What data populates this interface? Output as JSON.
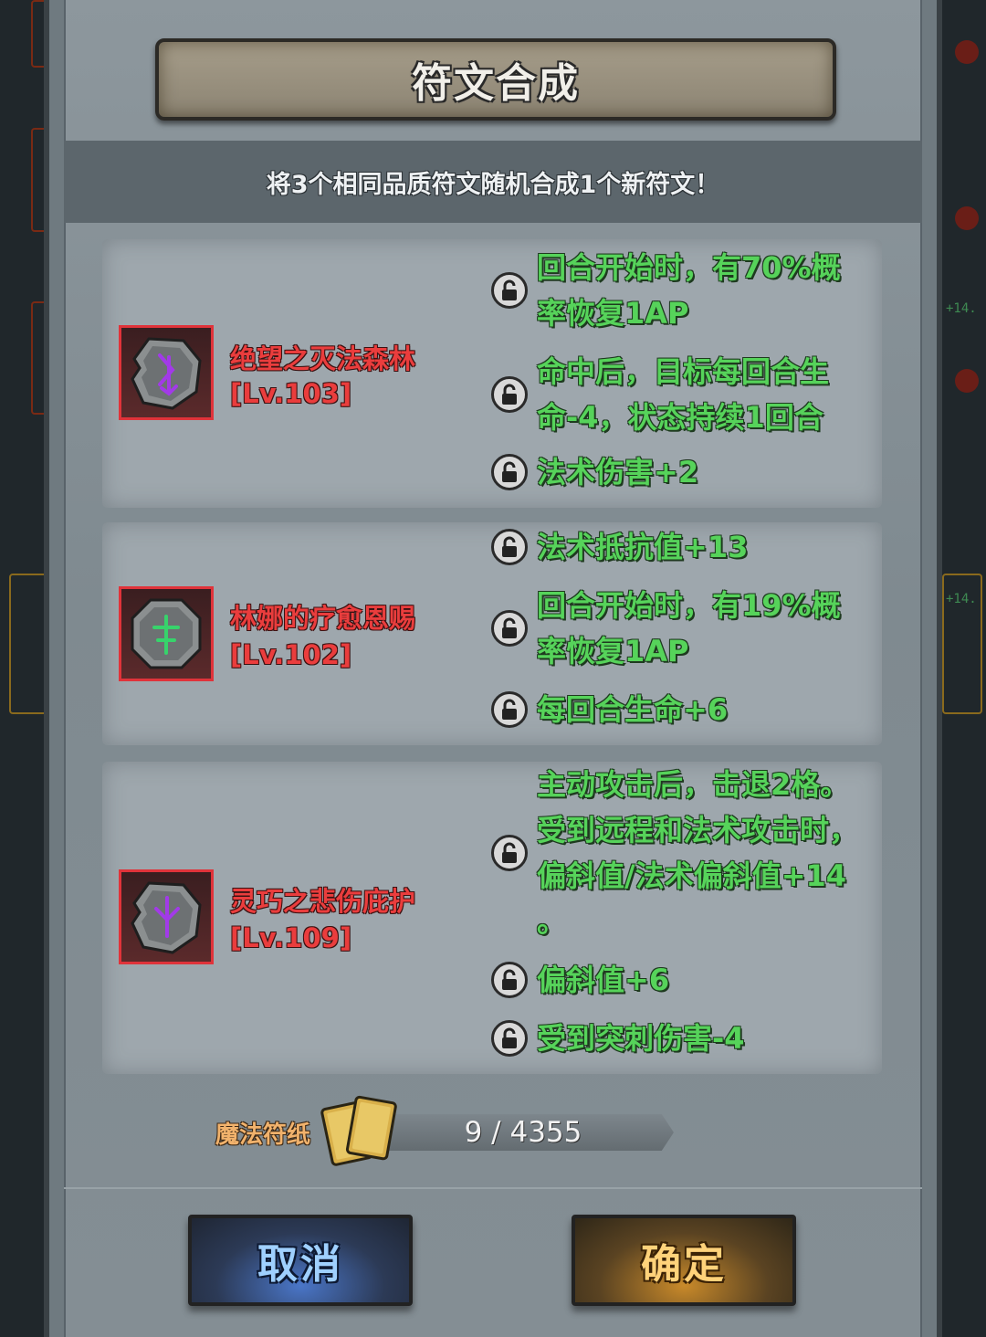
{
  "dialog": {
    "title": "符文合成",
    "subtitle": "将3个相同品质符文随机合成1个新符文！"
  },
  "runes": [
    {
      "name": "绝望之灭法森林",
      "level": "[Lv.103]",
      "glyph_color": "#a23ae8",
      "attributes": [
        {
          "text": "回合开始时，有70%概\n率恢复1AP",
          "locked": true
        },
        {
          "text": "命中后，目标每回合生\n命-4，状态持续1回合",
          "locked": true
        },
        {
          "text": "法术伤害+2",
          "locked": true
        }
      ]
    },
    {
      "name": "林娜的疗愈恩赐",
      "level": "[Lv.102]",
      "glyph_color": "#37d36b",
      "attributes": [
        {
          "text": "法术抵抗值+13",
          "locked": true
        },
        {
          "text": "回合开始时，有19%概\n率恢复1AP",
          "locked": true
        },
        {
          "text": "每回合生命+6",
          "locked": true
        }
      ]
    },
    {
      "name": "灵巧之悲伤庇护",
      "level": "[Lv.109]",
      "glyph_color": "#a23ae8",
      "attributes": [
        {
          "text": "主动攻击后，击退2格。\n受到远程和法术攻击时，\n偏斜值/法术偏斜值+14\n。",
          "locked": true
        },
        {
          "text": "偏斜值+6",
          "locked": true
        },
        {
          "text": "受到突刺伤害-4",
          "locked": true
        }
      ]
    }
  ],
  "magic_paper": {
    "label": "魔法符纸",
    "count_text": "9 / 4355",
    "current": 9,
    "required": 4355
  },
  "buttons": {
    "cancel": "取消",
    "confirm": "确定"
  },
  "colors": {
    "rune_name": "#ea3d3d",
    "attribute_text": "#56d35a",
    "cancel_text": "#9fd0ff",
    "confirm_text": "#ffd27a"
  }
}
